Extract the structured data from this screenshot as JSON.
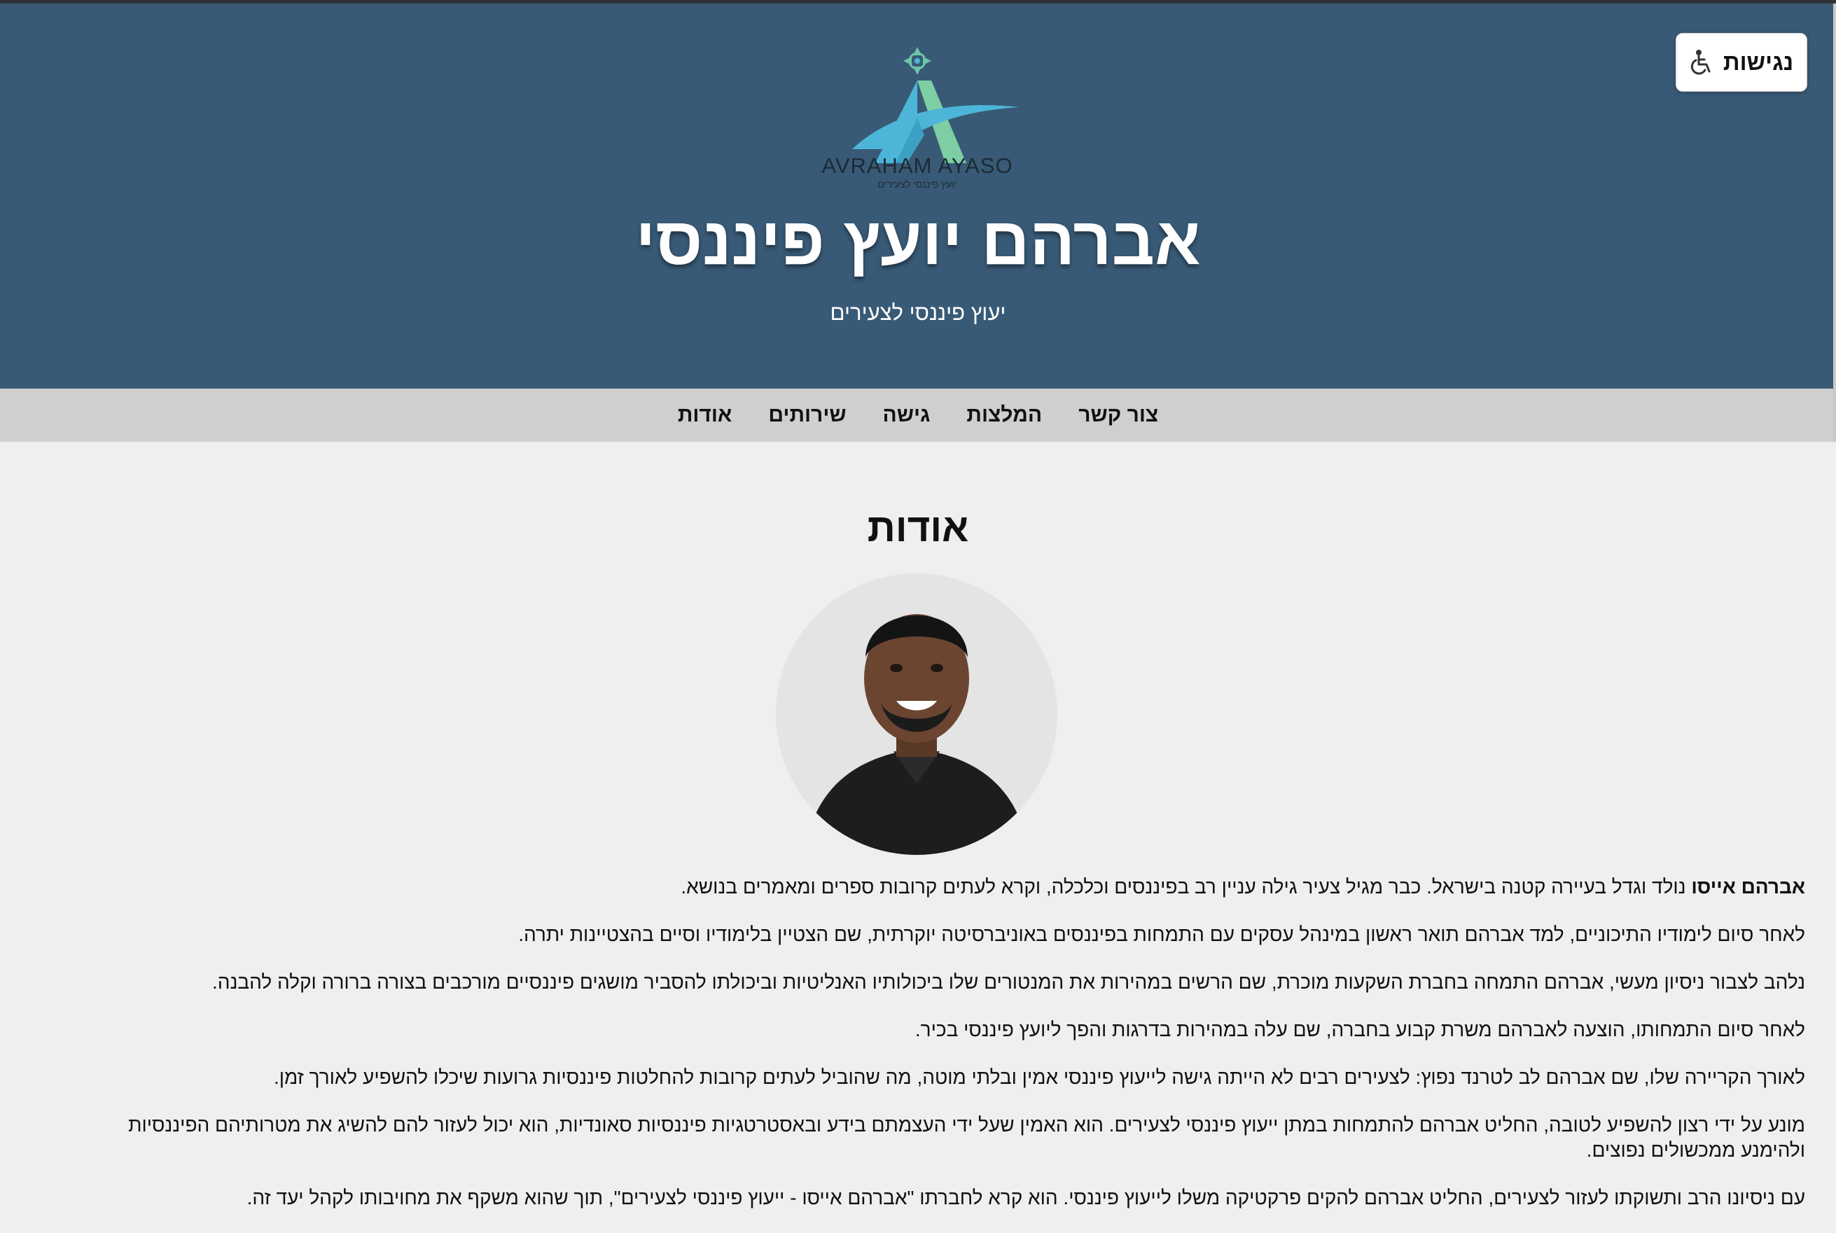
{
  "accessibility": {
    "label": "נגישות",
    "icon": "wheelchair-icon"
  },
  "header": {
    "logo_name": "AVRAHAM AYASO",
    "logo_tagline": "יועץ פיננסי לצעירים",
    "title": "אברהם יועץ פיננסי",
    "subtitle": "יעוץ פיננסי לצעירים",
    "background_color": "#385a76"
  },
  "nav": {
    "items": [
      {
        "label": "אודות"
      },
      {
        "label": "שירותים"
      },
      {
        "label": "גישה"
      },
      {
        "label": "המלצות"
      },
      {
        "label": "צור קשר"
      }
    ]
  },
  "about": {
    "title": "אודות",
    "name_bold": "אברהם אייסו",
    "p1": "נולד וגדל בעיירה קטנה בישראל. כבר מגיל צעיר גילה עניין רב בפיננסים וכלכלה, וקרא לעתים קרובות ספרים ומאמרים בנושא.",
    "p2": "לאחר סיום לימודיו התיכוניים, למד אברהם תואר ראשון במינהל עסקים עם התמחות בפיננסים באוניברסיטה יוקרתית, שם הצטיין בלימודיו וסיים בהצטיינות יתרה.",
    "p3": "נלהב לצבור ניסיון מעשי, אברהם התמחה בחברת השקעות מוכרת, שם הרשים במהירות את המנטורים שלו ביכולותיו האנליטיות וביכולתו להסביר מושגים פיננסיים מורכבים בצורה ברורה וקלה להבנה.",
    "p4": "לאחר סיום התמחותו, הוצעה לאברהם משרת קבוע בחברה, שם עלה במהירות בדרגות והפך ליועץ פיננסי בכיר.",
    "p5": "לאורך הקריירה שלו, שם אברהם לב לטרנד נפוץ: לצעירים רבים לא הייתה גישה לייעוץ פיננסי אמין ובלתי מוטה, מה שהוביל לעתים קרובות להחלטות פיננסיות גרועות שיכלו להשפיע לאורך זמן.",
    "p6": "מונע על ידי רצון להשפיע לטובה, החליט אברהם להתמחות במתן ייעוץ פיננסי לצעירים. הוא האמין שעל ידי העצמתם בידע ובאסטרטגיות פיננסיות סאונדיות, הוא יכול לעזור להם להשיג את מטרותיהם הפיננסיות ולהימנע ממכשולים נפוצים.",
    "p7": "עם ניסיונו הרב ותשוקתו לעזור לצעירים, החליט אברהם להקים פרקטיקה משלו לייעוץ פיננסי. הוא קרא לחברתו \"אברהם אייסו - ייעוץ פיננסי לצעירים\", תוך שהוא משקף את מחויבותו לקהל יעד זה."
  }
}
